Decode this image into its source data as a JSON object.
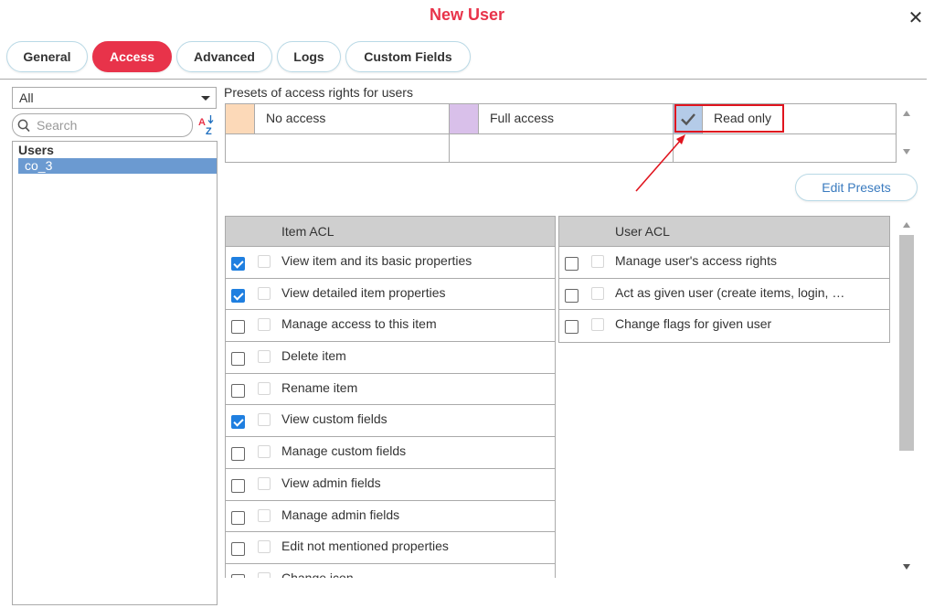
{
  "window": {
    "title": "New User",
    "close_glyph": "✕"
  },
  "tabs": [
    {
      "label": "General",
      "active": false
    },
    {
      "label": "Access",
      "active": true
    },
    {
      "label": "Advanced",
      "active": false
    },
    {
      "label": "Logs",
      "active": false
    },
    {
      "label": "Custom Fields",
      "active": false
    }
  ],
  "left_panel": {
    "filter_value": "All",
    "search_placeholder": "Search",
    "list_header": "Users",
    "selected_user": "co_3"
  },
  "presets": {
    "label": "Presets of access rights for users",
    "items": [
      {
        "name": "No access",
        "color": "#fcd9b8"
      },
      {
        "name": "Full access",
        "color": "#d9c0ea"
      },
      {
        "name": "Read only",
        "color": "#b4cbe8",
        "checked": true
      }
    ],
    "edit_button": "Edit Presets"
  },
  "item_acl": {
    "header": "Item ACL",
    "rows": [
      {
        "label": "View item and its basic properties",
        "checked": true
      },
      {
        "label": "View detailed item properties",
        "checked": true
      },
      {
        "label": "Manage access to this item",
        "checked": false
      },
      {
        "label": "Delete item",
        "checked": false
      },
      {
        "label": "Rename item",
        "checked": false
      },
      {
        "label": "View custom fields",
        "checked": true
      },
      {
        "label": "Manage custom fields",
        "checked": false
      },
      {
        "label": "View admin fields",
        "checked": false
      },
      {
        "label": "Manage admin fields",
        "checked": false
      },
      {
        "label": "Edit not mentioned properties",
        "checked": false
      },
      {
        "label": "Change icon",
        "checked": false
      }
    ]
  },
  "user_acl": {
    "header": "User ACL",
    "rows": [
      {
        "label": "Manage user's access rights",
        "checked": false
      },
      {
        "label": "Act as given user (create items, login, …",
        "checked": false
      },
      {
        "label": "Change flags for given user",
        "checked": false
      }
    ]
  },
  "colors": {
    "accent": "#e8334a",
    "checkbox_on": "#1f7fe0",
    "selection": "#6b9ad1",
    "annotation": "#e0141e"
  }
}
